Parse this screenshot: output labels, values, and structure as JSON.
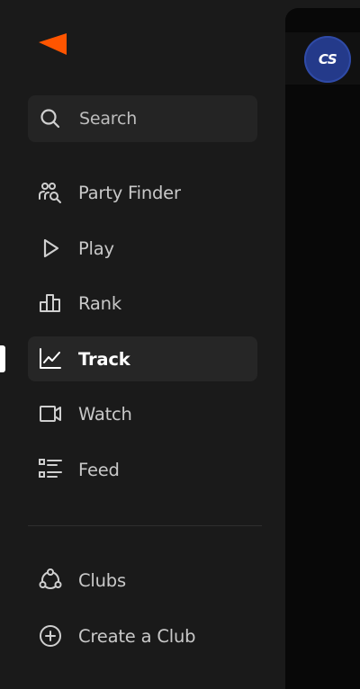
{
  "brand": {
    "logo_icon": "faceit-logo-icon",
    "accent_color": "#ff5500"
  },
  "search": {
    "label": "Search",
    "icon": "search-icon"
  },
  "nav": {
    "items": [
      {
        "label": "Party Finder",
        "icon": "party-finder-icon",
        "active": false
      },
      {
        "label": "Play",
        "icon": "play-icon",
        "active": false
      },
      {
        "label": "Rank",
        "icon": "rank-icon",
        "active": false
      },
      {
        "label": "Track",
        "icon": "track-icon",
        "active": true
      },
      {
        "label": "Watch",
        "icon": "watch-icon",
        "active": false
      },
      {
        "label": "Feed",
        "icon": "feed-icon",
        "active": false
      }
    ]
  },
  "clubs": {
    "items": [
      {
        "label": "Clubs",
        "icon": "clubs-icon"
      },
      {
        "label": "Create a Club",
        "icon": "add-circle-icon"
      }
    ]
  },
  "game": {
    "badge_text": "CS",
    "badge_color": "#243a8a"
  }
}
